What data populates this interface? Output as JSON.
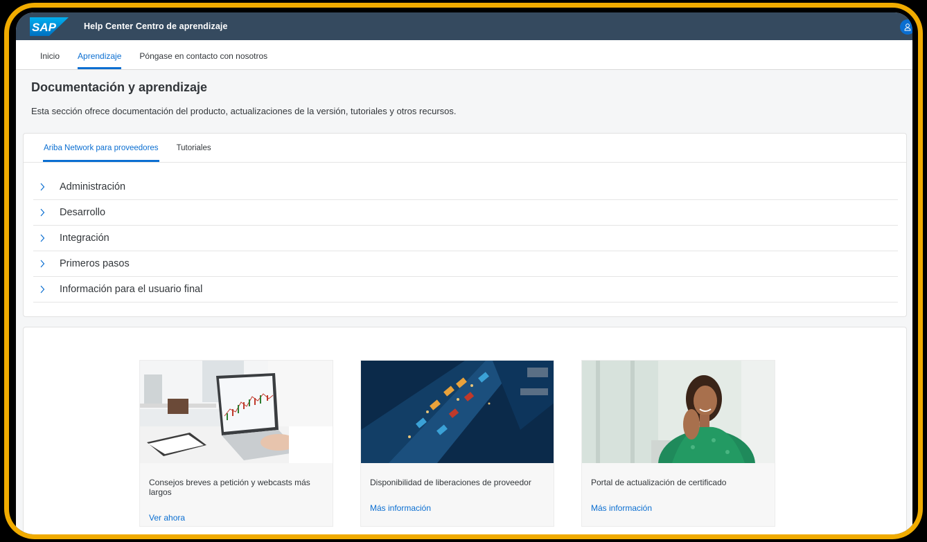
{
  "shell": {
    "logo_text": "SAP",
    "title": "Help Center Centro de aprendizaje"
  },
  "nav": {
    "items": [
      {
        "label": "Inicio",
        "active": false
      },
      {
        "label": "Aprendizaje",
        "active": true
      },
      {
        "label": "Póngase en contacto con nosotros",
        "active": false
      }
    ]
  },
  "page": {
    "title": "Documentación y aprendizaje",
    "description": "Esta sección ofrece documentación del producto, actualizaciones de la versión, tutoriales y otros recursos."
  },
  "tabs": [
    {
      "label": "Ariba Network para proveedores",
      "active": true
    },
    {
      "label": "Tutoriales",
      "active": false
    }
  ],
  "accordion": [
    {
      "label": "Administración"
    },
    {
      "label": "Desarrollo"
    },
    {
      "label": "Integración"
    },
    {
      "label": "Primeros pasos"
    },
    {
      "label": "Información para el usuario final"
    }
  ],
  "tiles": [
    {
      "caption": "Consejos breves a petición y webcasts más largos",
      "link": "Ver ahora"
    },
    {
      "caption": "Disponibilidad de liberaciones de proveedor",
      "link": "Más información"
    },
    {
      "caption": "Portal de actualización de certificado",
      "link": "Más información"
    }
  ],
  "colors": {
    "frame": "#f0ab00",
    "shell": "#354a5f",
    "accent": "#0a6ed1"
  }
}
